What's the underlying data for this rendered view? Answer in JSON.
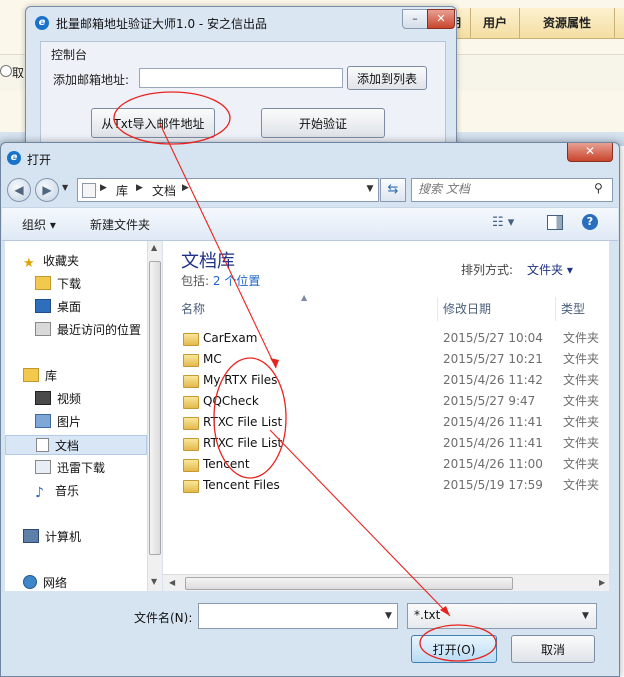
{
  "background_app": {
    "header_cols": [
      "期",
      "用户",
      "资源属性"
    ],
    "radio_label": "取"
  },
  "app_window": {
    "title": "批量邮箱地址验证大师1.0 - 安之信出品",
    "minimize": "–",
    "maximize": "□",
    "close": "✕",
    "panel_label": "控制台",
    "email_label": "添加邮箱地址:",
    "email_value": "",
    "add_button": "添加到列表",
    "import_button": "从Txt导入邮件地址",
    "start_button": "开始验证"
  },
  "dialog": {
    "title": "打开",
    "close": "✕",
    "breadcrumb": [
      "库",
      "文档"
    ],
    "search_placeholder": "搜索 文档",
    "toolbar": {
      "organize": "组织 ▾",
      "new_folder": "新建文件夹"
    },
    "nav": {
      "favorites": "收藏夹",
      "downloads": "下载",
      "desktop": "桌面",
      "recent": "最近访问的位置",
      "libraries": "库",
      "videos": "视频",
      "pictures": "图片",
      "documents": "文档",
      "thunder": "迅雷下载",
      "music": "音乐",
      "computer": "计算机",
      "network": "网络"
    },
    "library_title": "文档库",
    "library_sub_prefix": "包括:",
    "library_sub_link": "2 个位置",
    "arrange_label": "排列方式:",
    "arrange_value": "文件夹 ▾",
    "columns": {
      "name": "名称",
      "date": "修改日期",
      "type": "类型"
    },
    "files": [
      {
        "name": "CarExam",
        "date": "2015/5/27 10:04",
        "type": "文件夹"
      },
      {
        "name": "MC",
        "date": "2015/5/27 10:21",
        "type": "文件夹"
      },
      {
        "name": "My RTX Files",
        "date": "2015/4/26 11:42",
        "type": "文件夹"
      },
      {
        "name": "QQCheck",
        "date": "2015/5/27 9:47",
        "type": "文件夹"
      },
      {
        "name": "RTXC File List",
        "date": "2015/4/26 11:41",
        "type": "文件夹"
      },
      {
        "name": "RTXC File List",
        "date": "2015/4/26 11:41",
        "type": "文件夹"
      },
      {
        "name": "Tencent",
        "date": "2015/4/26 11:00",
        "type": "文件夹"
      },
      {
        "name": "Tencent Files",
        "date": "2015/5/19 17:59",
        "type": "文件夹"
      }
    ],
    "filename_label": "文件名(N):",
    "filename_value": "",
    "filetype_value": "*.txt",
    "open_button": "打开(O)",
    "cancel_button": "取消"
  },
  "colors": {
    "annotation": "#e8231e",
    "title_blue": "#1e3287"
  }
}
